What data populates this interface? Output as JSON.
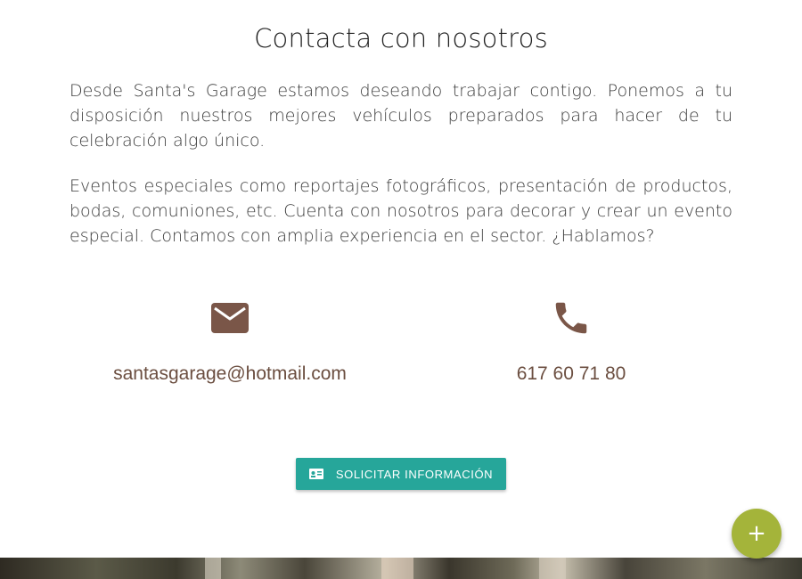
{
  "section": {
    "title": "Contacta con nosotros",
    "paragraphs": [
      "Desde Santa's Garage estamos deseando trabajar contigo. Ponemos a tu disposición nuestros mejores vehículos preparados para hacer de tu celebración algo único.",
      "Eventos especiales como reportajes fotográficos, presentación de productos, bodas, comuniones, etc. Cuenta con nosotros para decorar y crear un evento especial. Contamos con amplia experiencia en el sector. ¿Hablamos?"
    ]
  },
  "contacts": {
    "email": {
      "icon": "mail-icon",
      "value": "santasgarage@hotmail.com"
    },
    "phone": {
      "icon": "phone-icon",
      "value": "617 60 71 80"
    }
  },
  "cta": {
    "icon": "contact-card-icon",
    "label": "SOLICITAR INFORMACIÓN"
  },
  "fab": {
    "icon": "plus-icon",
    "label": "+"
  },
  "colors": {
    "icon_brown": "#7a5648",
    "text_brown": "#6b4e40",
    "button_teal": "#26a69a",
    "fab_olive": "#a4b43a"
  }
}
